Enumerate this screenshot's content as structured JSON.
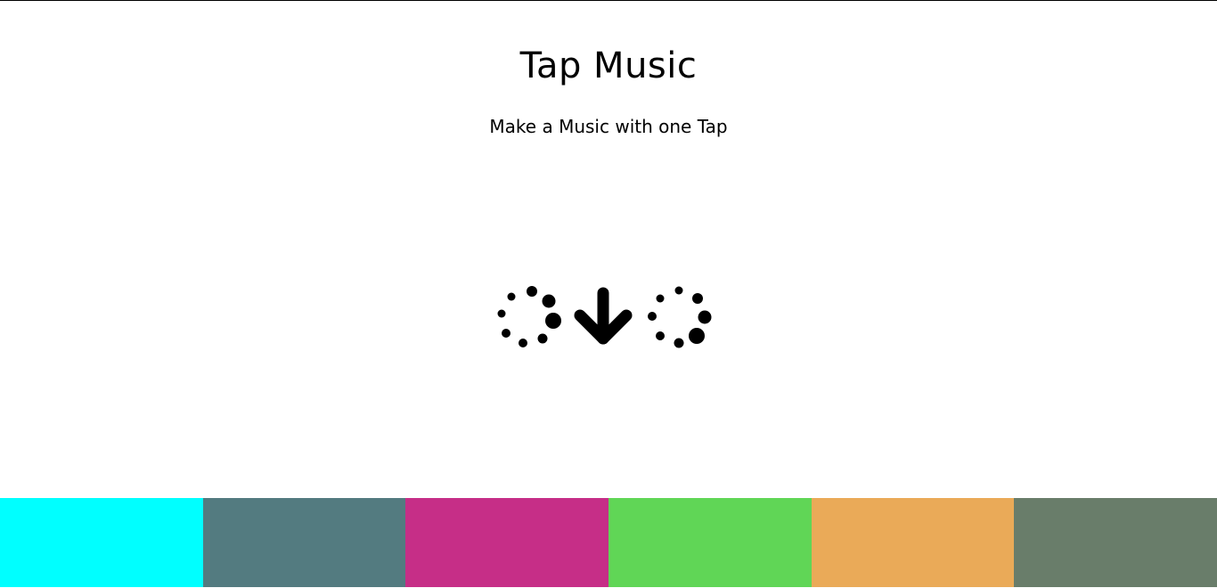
{
  "header": {
    "title": "Tap Music",
    "subtitle": "Make a Music with one Tap"
  },
  "hint": {
    "left_icon": "loading-dots-icon",
    "center_icon": "arrow-down-icon",
    "right_icon": "loading-dots-icon"
  },
  "pads": [
    {
      "name": "pad-1",
      "color": "#00FFFF"
    },
    {
      "name": "pad-2",
      "color": "#537B80"
    },
    {
      "name": "pad-3",
      "color": "#C62E87"
    },
    {
      "name": "pad-4",
      "color": "#60D656"
    },
    {
      "name": "pad-5",
      "color": "#EAAA58"
    },
    {
      "name": "pad-6",
      "color": "#697D6A"
    }
  ]
}
